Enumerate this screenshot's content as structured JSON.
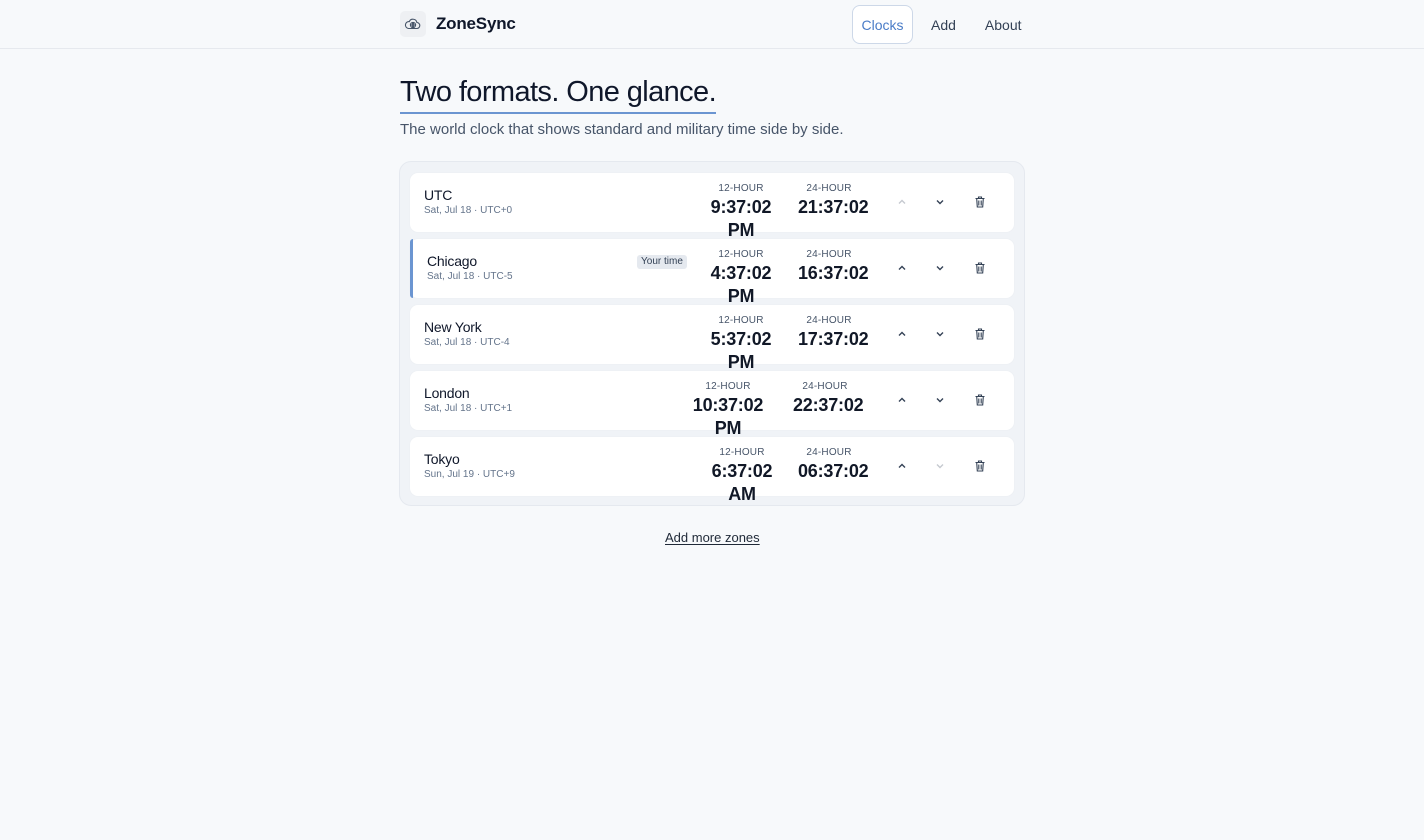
{
  "app": {
    "name": "ZoneSync",
    "logo_icon": "cloud-globe-icon"
  },
  "nav": {
    "items": [
      {
        "label": "Clocks",
        "active": true
      },
      {
        "label": "Add",
        "active": false
      },
      {
        "label": "About",
        "active": false
      }
    ]
  },
  "hero": {
    "title": "Two formats. One glance.",
    "subtitle": "The world clock that shows standard and military time side by side."
  },
  "labels": {
    "h12": "12-HOUR",
    "h24": "24-HOUR"
  },
  "clocks": [
    {
      "city": "UTC",
      "meta": "Sat, Jul 18 · UTC+0",
      "t12": "9:37:02 PM",
      "t24": "21:37:02",
      "up_enabled": false,
      "down_enabled": true,
      "badge": ""
    },
    {
      "city": "Chicago",
      "meta": "Sat, Jul 18 · UTC-5",
      "t12": "4:37:02 PM",
      "t24": "16:37:02",
      "up_enabled": true,
      "down_enabled": true,
      "badge": "Your time"
    },
    {
      "city": "New York",
      "meta": "Sat, Jul 18 · UTC-4",
      "t12": "5:37:02 PM",
      "t24": "17:37:02",
      "up_enabled": true,
      "down_enabled": true,
      "badge": ""
    },
    {
      "city": "London",
      "meta": "Sat, Jul 18 · UTC+1",
      "t12": "10:37:02 PM",
      "t24": "22:37:02",
      "up_enabled": true,
      "down_enabled": true,
      "badge": ""
    },
    {
      "city": "Tokyo",
      "meta": "Sun, Jul 19 · UTC+9",
      "t12": "6:37:02 AM",
      "t24": "06:37:02",
      "up_enabled": true,
      "down_enabled": false,
      "badge": ""
    }
  ],
  "footer": {
    "add_more": "Add more zones"
  },
  "colors": {
    "accent": "#6b95d1",
    "nav_active": "#4a7cc7",
    "background": "#f7f9fb"
  }
}
